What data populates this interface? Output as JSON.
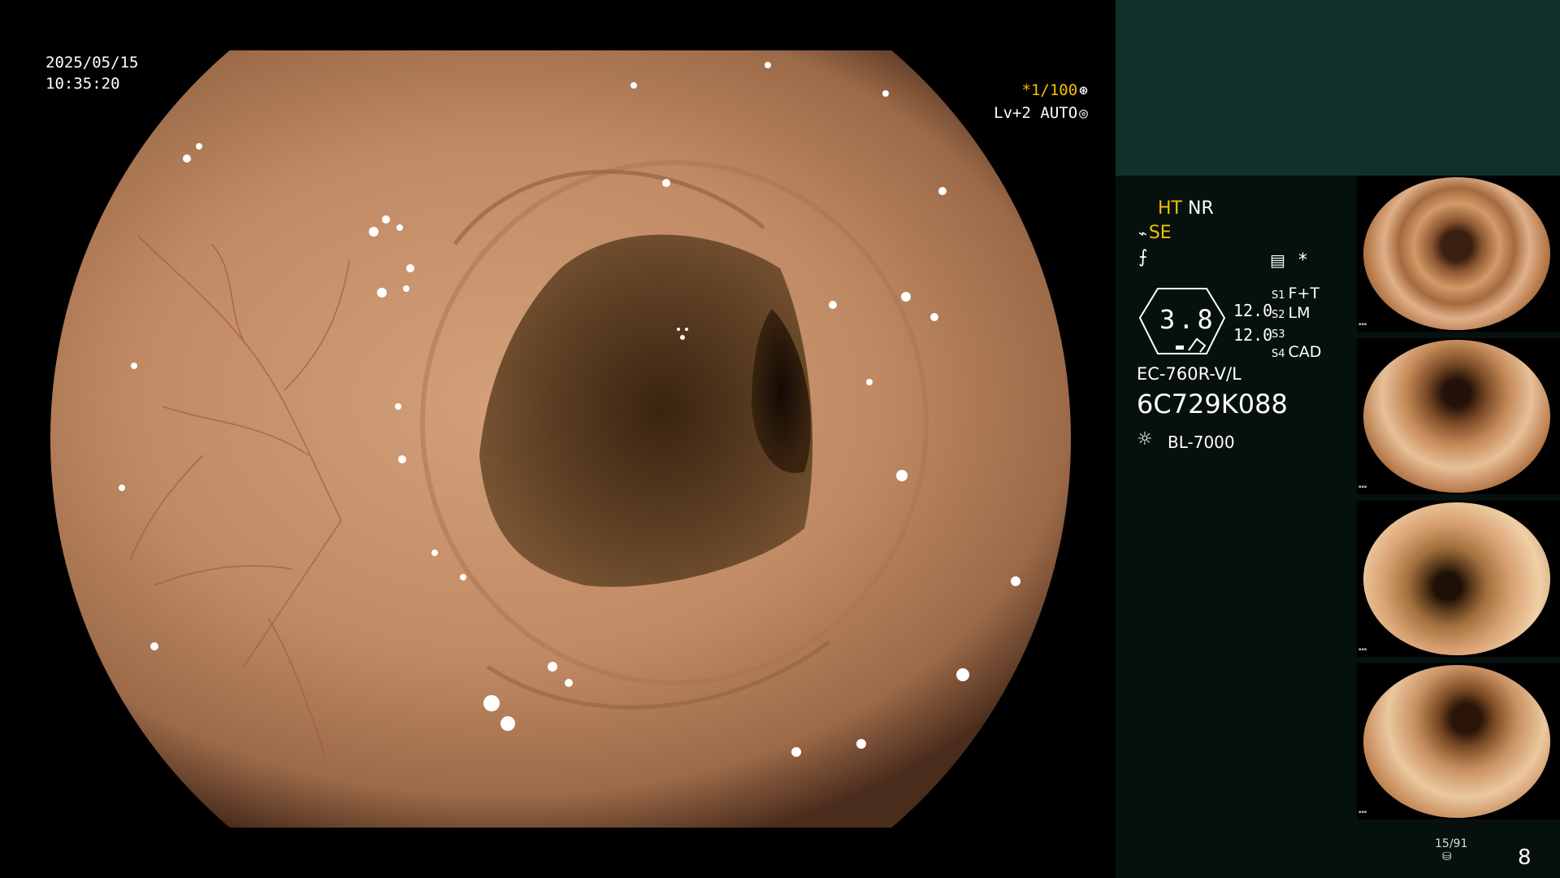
{
  "overlay": {
    "date": "2025/05/15",
    "time": "10:35:20",
    "shutter": "*1/100",
    "shutter_icon": "aperture-icon",
    "level": "Lv+2",
    "mode": "AUTO",
    "mode_icon": "auto-iris-icon"
  },
  "panel": {
    "ht": "HT",
    "nr": "NR",
    "se": "SE",
    "gauge_value": "3.8",
    "num_top": "12.0",
    "num_bottom": "12.0",
    "s1_label": "S1",
    "s1_value": "F+T",
    "s2_label": "S2",
    "s2_value": "LM",
    "s3_label": "S3",
    "s3_value": "",
    "s4_label": "S4",
    "s4_value": "CAD",
    "scope_model": "EC-760R-V/L",
    "scope_serial": "6C729K088",
    "light_source": "BL-7000",
    "star": "*",
    "counter": "15/91",
    "page": "8"
  },
  "colors": {
    "accent_yellow": "#f0c000",
    "panel_top": "#12302b",
    "panel_bg": "#06100f"
  }
}
